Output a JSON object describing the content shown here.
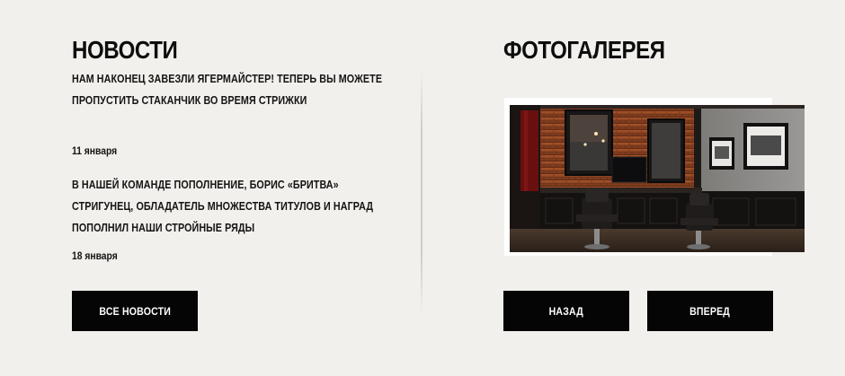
{
  "news": {
    "title": "НОВОСТИ",
    "items": [
      {
        "text": "НАМ НАКОНЕЦ ЗАВЕЗЛИ ЯГЕРМАЙСТЕР! ТЕПЕРЬ ВЫ МОЖЕТЕ ПРОПУСТИТЬ СТАКАНЧИК ВО ВРЕМЯ СТРИЖКИ",
        "date": "11 января"
      },
      {
        "text": "В НАШЕЙ КОМАНДЕ ПОПОЛНЕНИЕ, БОРИС «БРИТВА» СТРИГУНЕЦ, ОБЛАДАТЕЛЬ МНОЖЕСТВА ТИТУЛОВ И НАГРАД ПОПОЛНИЛ НАШИ СТРОЙНЫЕ РЯДЫ",
        "date": "18 января"
      }
    ],
    "all_news_label": "ВСЕ НОВОСТИ"
  },
  "gallery": {
    "title": "ФОТОГАЛЕРЕЯ",
    "photo_icon": "barbershop-interior-photo",
    "prev_label": "НАЗАД",
    "next_label": "ВПЕРЕД"
  },
  "colors": {
    "background": "#f2f0ec",
    "button": "#050505",
    "button_text": "#ffffff",
    "text": "#111111"
  }
}
